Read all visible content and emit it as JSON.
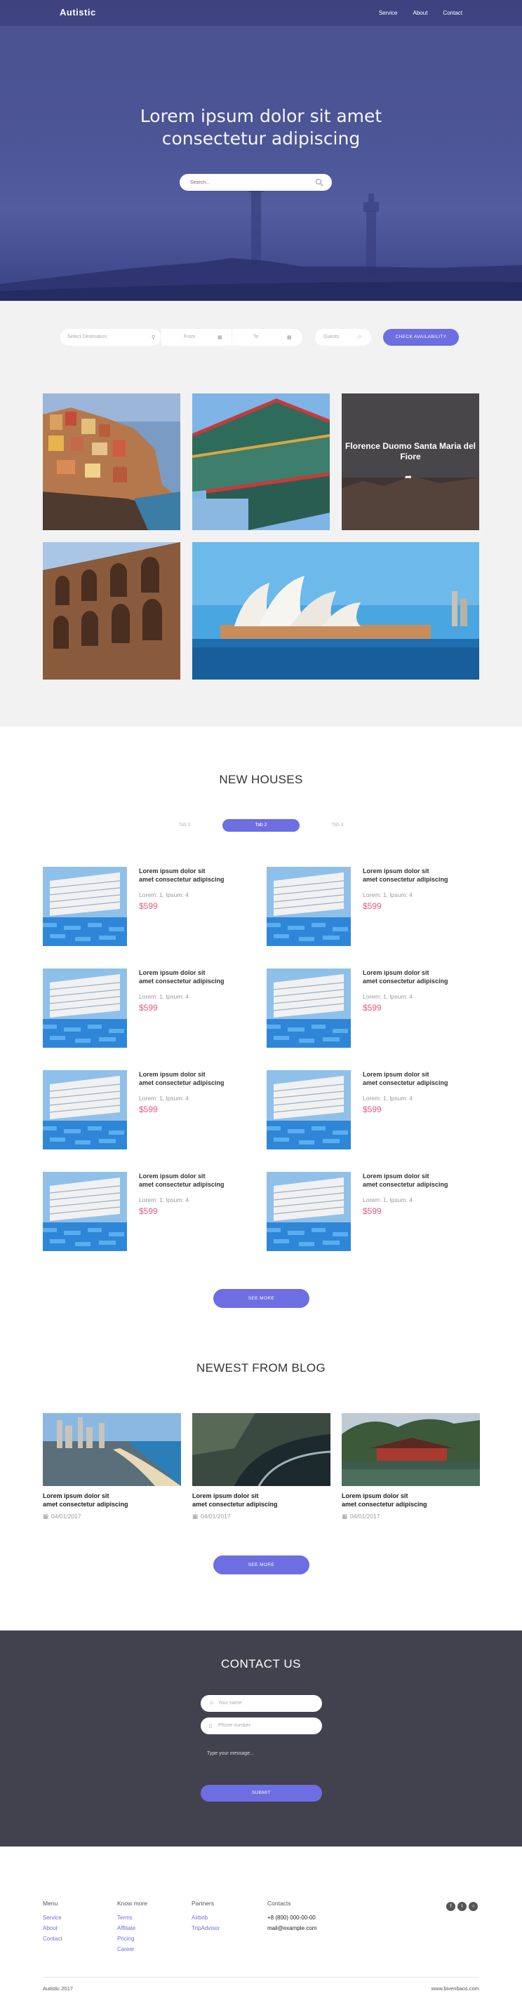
{
  "nav": {
    "logo": "Autistic",
    "links": [
      "Service",
      "About",
      "Contact"
    ]
  },
  "hero": {
    "title_line1": "Lorem ipsum dolor sit amet",
    "title_line2": "consectetur adipiscing",
    "search_placeholder": "Search..."
  },
  "booking": {
    "destination": "Select Destination",
    "from": "From",
    "to": "To",
    "guests": "Guests",
    "button": "CHECK AVAILABILITY"
  },
  "gallery": {
    "feature_title": "Florence Duomo Santa Maria del Fiore"
  },
  "houses": {
    "title": "NEW HOUSES",
    "tabs": [
      "Tab 1",
      "Tab 2",
      "Tab 3"
    ],
    "active_tab": 1,
    "item": {
      "title_line1": "Lorem ipsum dolor sit",
      "title_line2": "amet consectetur adipiscing",
      "meta": "Lorem: 1, Ipsum: 4",
      "price": "$599"
    },
    "count": 8,
    "see_more": "SEE MORE"
  },
  "blog": {
    "title": "NEWEST FROM BLOG",
    "posts": [
      {
        "title_line1": "Lorem ipsum dolor sit",
        "title_line2": "amet consectetur adipiscing",
        "date": "04/01/2017"
      },
      {
        "title_line1": "Lorem ipsum dolor sit",
        "title_line2": "amet consectetur adipiscing",
        "date": "04/01/2017"
      },
      {
        "title_line1": "Lorem ipsum dolor sit",
        "title_line2": "amet consectetur adipiscing",
        "date": "04/01/2017"
      }
    ],
    "see_more": "SEE MORE"
  },
  "contact": {
    "title": "CONTACT US",
    "name_placeholder": "Your name",
    "phone_placeholder": "Phone number",
    "message_placeholder": "Type your message...",
    "submit": "SUBMIT"
  },
  "footer": {
    "menu": {
      "heading": "Menu",
      "items": [
        "Service",
        "About",
        "Contact"
      ]
    },
    "know": {
      "heading": "Know more",
      "items": [
        "Terms",
        "Affiliate",
        "Pricing",
        "Career"
      ]
    },
    "partners": {
      "heading": "Partners",
      "items": [
        "Airbnb",
        "TripAdvisor"
      ]
    },
    "contacts": {
      "heading": "Contacts",
      "phone": "+8 (800) 000-00-00",
      "email": "mail@example.com"
    },
    "copyright": "Autistic 2017",
    "site": "www.bivenbaos.com"
  },
  "colors": {
    "accent": "#6c6ee2",
    "price": "#e85a7a",
    "hero": "#4a5190",
    "contact_bg": "#42414e"
  }
}
